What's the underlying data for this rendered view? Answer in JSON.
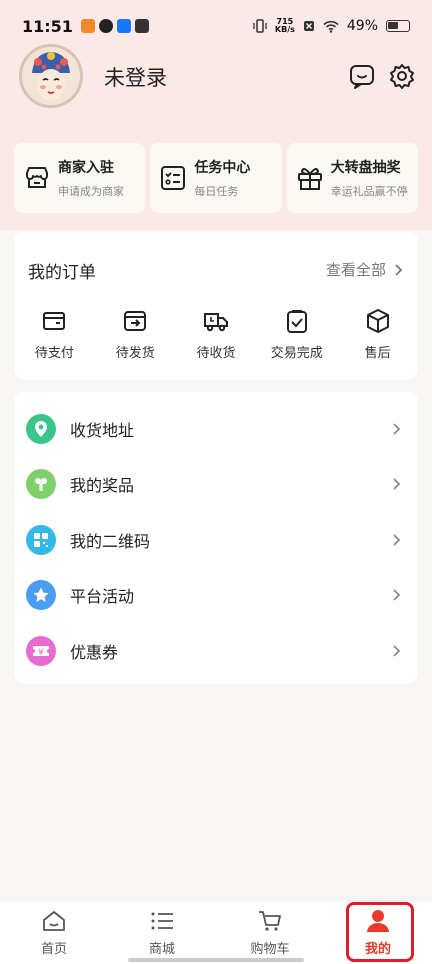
{
  "status_bar": {
    "time": "11:51",
    "speed_top": "715",
    "speed_bottom": "KB/s",
    "battery": "49%"
  },
  "header": {
    "login_text": "未登录"
  },
  "quick_cards": [
    {
      "title": "商家入驻",
      "subtitle": "申请成为商家",
      "icon": "store-icon"
    },
    {
      "title": "任务中心",
      "subtitle": "每日任务",
      "icon": "task-list-icon"
    },
    {
      "title": "大转盘抽奖",
      "subtitle": "幸运礼品赢不停",
      "icon": "gift-icon"
    }
  ],
  "orders": {
    "title": "我的订单",
    "view_all": "查看全部",
    "items": [
      {
        "label": "待支付",
        "icon": "wallet-icon"
      },
      {
        "label": "待发货",
        "icon": "ship-out-icon"
      },
      {
        "label": "待收货",
        "icon": "delivery-truck-icon"
      },
      {
        "label": "交易完成",
        "icon": "clipboard-check-icon"
      },
      {
        "label": "售后",
        "icon": "box-icon"
      }
    ]
  },
  "menu": [
    {
      "label": "收货地址",
      "icon": "location-pin-icon",
      "color": "#3cc58a"
    },
    {
      "label": "我的奖品",
      "icon": "prize-icon",
      "color": "#7fd06a"
    },
    {
      "label": "我的二维码",
      "icon": "qrcode-icon",
      "color": "#35b8e6"
    },
    {
      "label": "平台活动",
      "icon": "star-icon",
      "color": "#4a9ef0"
    },
    {
      "label": "优惠券",
      "icon": "coupon-icon",
      "color": "#e86bd0"
    }
  ],
  "tabs": [
    {
      "label": "首页",
      "icon": "home-icon"
    },
    {
      "label": "商城",
      "icon": "list-icon"
    },
    {
      "label": "购物车",
      "icon": "cart-icon"
    },
    {
      "label": "我的",
      "icon": "user-icon",
      "active": true
    }
  ],
  "colors": {
    "header_bg": "#fde8e8",
    "accent": "#e8392a",
    "highlight_border": "#e11d2a"
  }
}
